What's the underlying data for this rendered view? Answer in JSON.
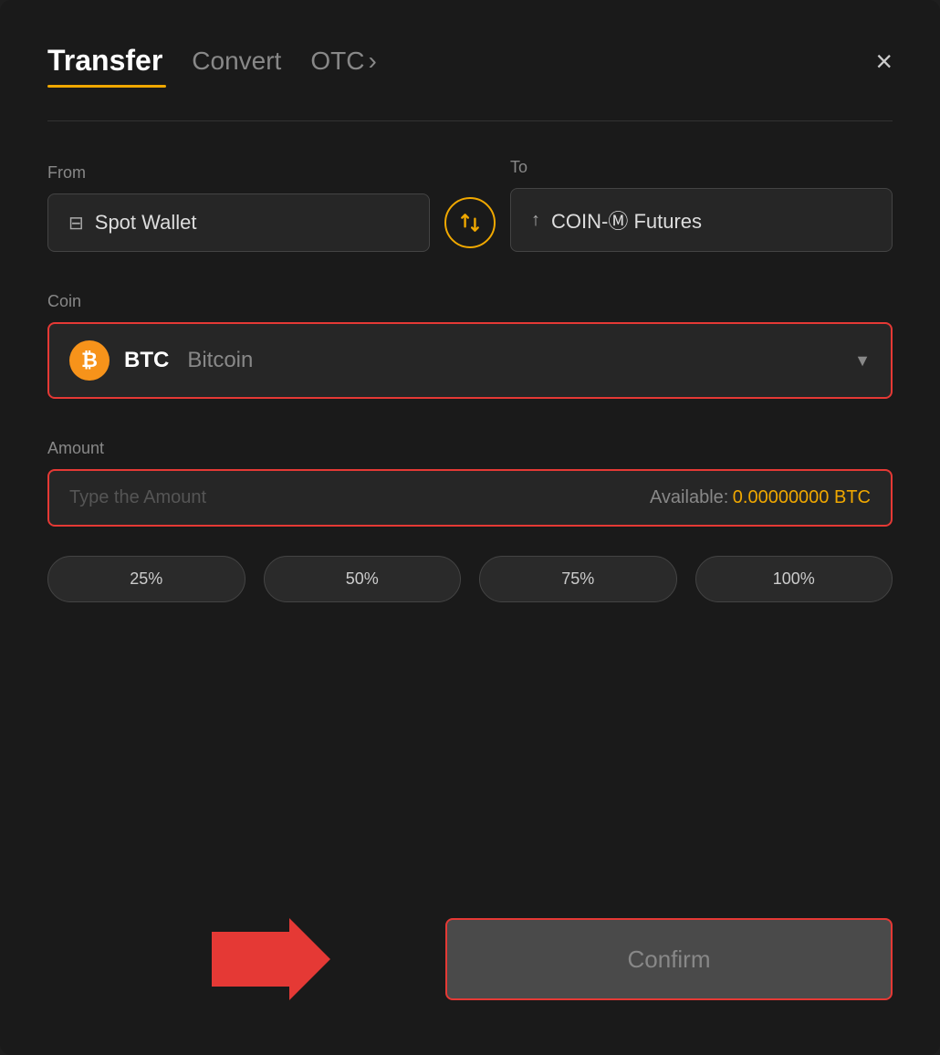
{
  "header": {
    "tab_transfer": "Transfer",
    "tab_convert": "Convert",
    "tab_otc": "OTC",
    "tab_otc_chevron": "›",
    "close_label": "×"
  },
  "from": {
    "label": "From",
    "wallet_icon": "▬",
    "wallet_name": "Spot Wallet"
  },
  "swap": {
    "icon": "⇄"
  },
  "to": {
    "label": "To",
    "wallet_icon": "↑",
    "wallet_name": "COIN-Ⓜ Futures"
  },
  "coin": {
    "label": "Coin",
    "symbol": "BTC",
    "full_name": "Bitcoin"
  },
  "amount": {
    "label": "Amount",
    "placeholder": "Type the Amount",
    "available_label": "Available:",
    "available_value": "0.00000000 BTC"
  },
  "percentages": [
    "25%",
    "50%",
    "75%",
    "100%"
  ],
  "confirm": {
    "label": "Confirm"
  }
}
